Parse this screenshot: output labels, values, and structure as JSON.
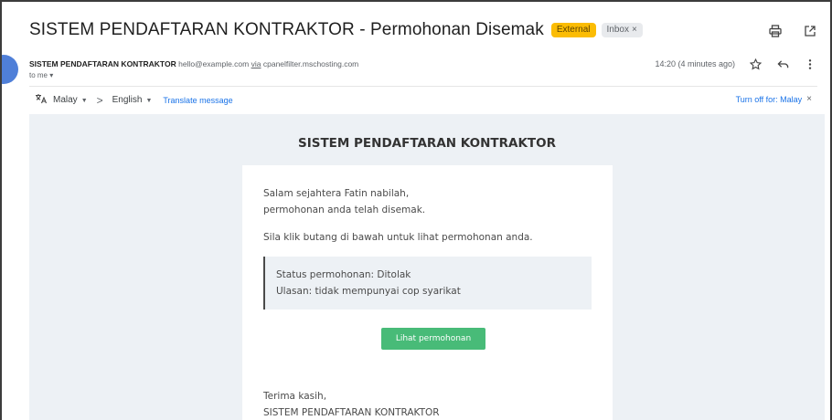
{
  "email": {
    "subject": "SISTEM PENDAFTARAN KONTRAKTOR - Permohonan Disemak",
    "labels": {
      "external": "External",
      "inbox": "Inbox",
      "inbox_close": "×"
    },
    "sender": {
      "name": "SISTEM PENDAFTARAN KONTRAKTOR",
      "email": "hello@example.com",
      "via_word": "via",
      "via_host": "cpanelfilter.mschosting.com",
      "to": "to me"
    },
    "time": "14:20 (4 minutes ago)",
    "icons": [
      "print-icon",
      "open-new-window-icon",
      "star-icon",
      "reply-icon",
      "more-vert-icon",
      "translate-icon"
    ]
  },
  "translate": {
    "from": "Malay",
    "to": "English",
    "action": "Translate message",
    "turn_off": "Turn off for: Malay",
    "turn_off_close": "×"
  },
  "body": {
    "header": "SISTEM PENDAFTARAN KONTRAKTOR",
    "greeting_line1": "Salam sejahtera Fatin nabilah,",
    "greeting_line2": "permohonan anda telah disemak.",
    "instruction": "Sila klik butang di bawah untuk lihat permohonan anda.",
    "status_line": "Status permohonan: Ditolak",
    "review_line": "Ulasan: tidak mempunyai cop syarikat",
    "button": "Lihat permohonan",
    "closing_line1": "Terima kasih,",
    "closing_line2": "SISTEM PENDAFTARAN KONTRAKTOR"
  },
  "colors": {
    "external_badge": "#fbbc04",
    "button": "#48bb78",
    "link": "#1a73e8",
    "body_background": "#edf1f5"
  }
}
